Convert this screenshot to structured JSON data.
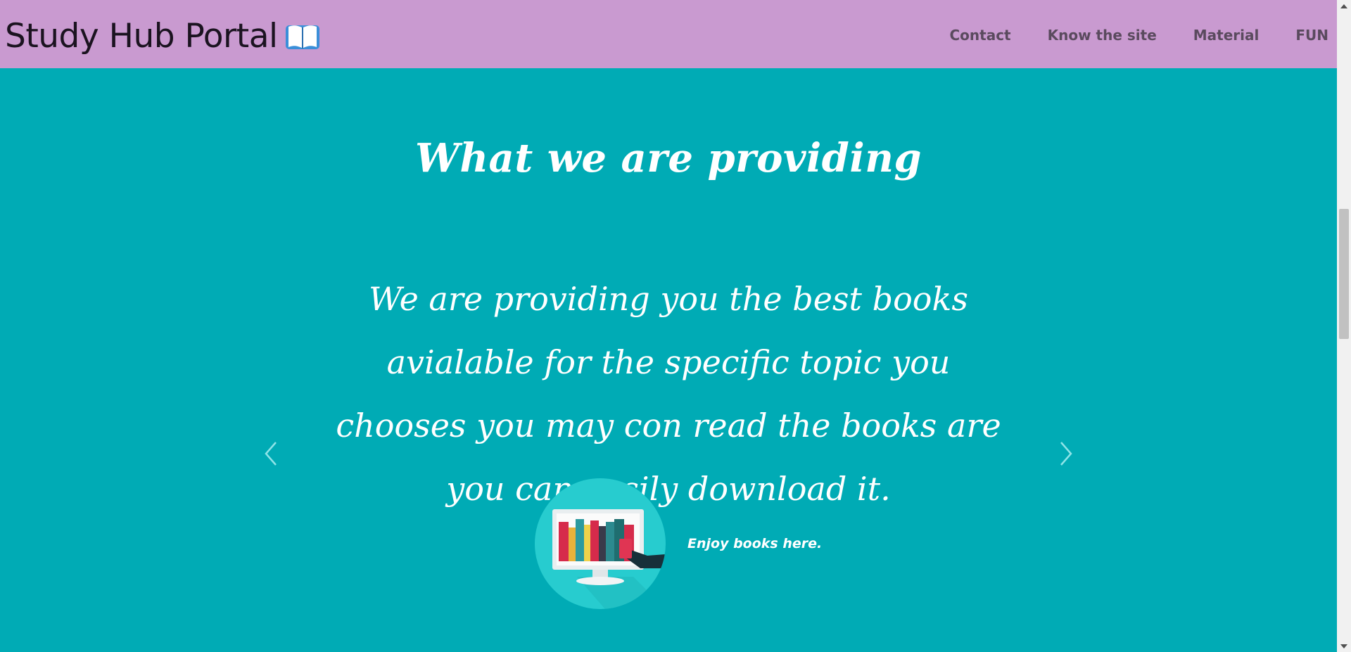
{
  "header": {
    "brand": "Study Hub Portal",
    "brand_icon": "open-book-icon",
    "nav": [
      "Contact",
      "Know the site",
      "Material",
      "FUN"
    ]
  },
  "main": {
    "title": "What we are providing",
    "slide_text": "We are providing you the best books avialable for the specific topic you chooses you may con read the books are you can easily download it.",
    "caption": "Enjoy books here.",
    "prev_icon": "chevron-left-icon",
    "next_icon": "chevron-right-icon"
  },
  "colors": {
    "navbar": "#c99ad0",
    "background": "#00abb5",
    "circle": "#27cccf"
  }
}
